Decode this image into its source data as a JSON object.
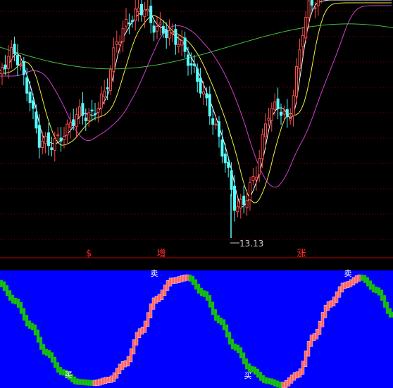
{
  "colors": {
    "background": "#000000",
    "grid": "#8b0000",
    "candle_up": "#ff4a4a",
    "candle_down": "#54ffff",
    "ma_white": "#ffffff",
    "ma_yellow": "#f0f040",
    "ma_magenta": "#d040d0",
    "ma_green": "#40c040",
    "divider": "#c00000",
    "marker_text": "#ff3030",
    "indicator_bg": "#0000ff",
    "osc_rising": "#ff6060",
    "osc_falling": "#18c018",
    "low_label": "#c8c8c8"
  },
  "low_label": "13.13",
  "markers": [
    "$",
    "增",
    "涨"
  ],
  "osc_labels": [
    "卖",
    "买"
  ],
  "chart_data": [
    {
      "type": "candlestick",
      "title": "",
      "grid": true,
      "lowest_low": 13.13,
      "series": [
        {
          "name": "",
          "role": "fast moving average (white)"
        },
        {
          "name": "",
          "role": "moving average (yellow)"
        },
        {
          "name": "",
          "role": "moving average (magenta)"
        },
        {
          "name": "",
          "role": "long moving average (green)"
        }
      ],
      "annotations": [
        "$",
        "增",
        "涨",
        "13.13"
      ]
    },
    {
      "type": "area",
      "title": "",
      "background": "blue",
      "description_labels": [
        "卖",
        "买",
        "买",
        "卖"
      ],
      "cycle_values": [
        0.95,
        0.78,
        0.55,
        0.3,
        0.12,
        0.03,
        0.02,
        0.05,
        0.2,
        0.5,
        0.8,
        0.97,
        1.0,
        0.85,
        0.6,
        0.35,
        0.15,
        0.04,
        0.0,
        0.1,
        0.45,
        0.75,
        0.93,
        1.0,
        0.88,
        0.65
      ]
    }
  ]
}
